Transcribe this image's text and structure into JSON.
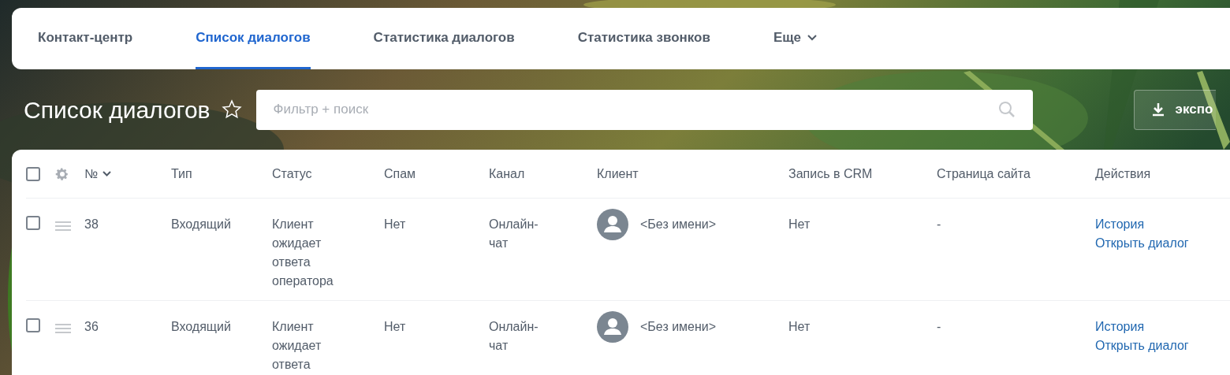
{
  "tabs": [
    {
      "label": "Контакт-центр",
      "selected": false,
      "kind": "tab"
    },
    {
      "label": "Список диалогов",
      "selected": true,
      "kind": "tab"
    },
    {
      "label": "Статистика диалогов",
      "selected": false,
      "kind": "tab"
    },
    {
      "label": "Статистика звонков",
      "selected": false,
      "kind": "tab"
    },
    {
      "label": "Еще",
      "selected": false,
      "kind": "more"
    }
  ],
  "page_title": "Список диалогов",
  "favorite": false,
  "search": {
    "placeholder": "Фильтр + поиск"
  },
  "export_button": "экспо",
  "table": {
    "select_all_checked": false,
    "columns": [
      "№",
      "Тип",
      "Статус",
      "Спам",
      "Канал",
      "Клиент",
      "Запись в CRM",
      "Страница сайта",
      "Действия"
    ],
    "rows": [
      {
        "checked": false,
        "number": "38",
        "type": "Входящий",
        "status": "Клиент ожидает ответа оператора",
        "spam": "Нет",
        "channel": "Онлайн-чат",
        "client": "<Без имени>",
        "crm": "Нет",
        "site_page": "-",
        "actions": [
          "История",
          "Открыть диалог"
        ]
      },
      {
        "checked": false,
        "number": "36",
        "type": "Входящий",
        "status": "Клиент ожидает ответа",
        "spam": "Нет",
        "channel": "Онлайн-чат",
        "client": "<Без имени>",
        "crm": "Нет",
        "site_page": "-",
        "actions": [
          "История",
          "Открыть диалог"
        ]
      }
    ]
  }
}
